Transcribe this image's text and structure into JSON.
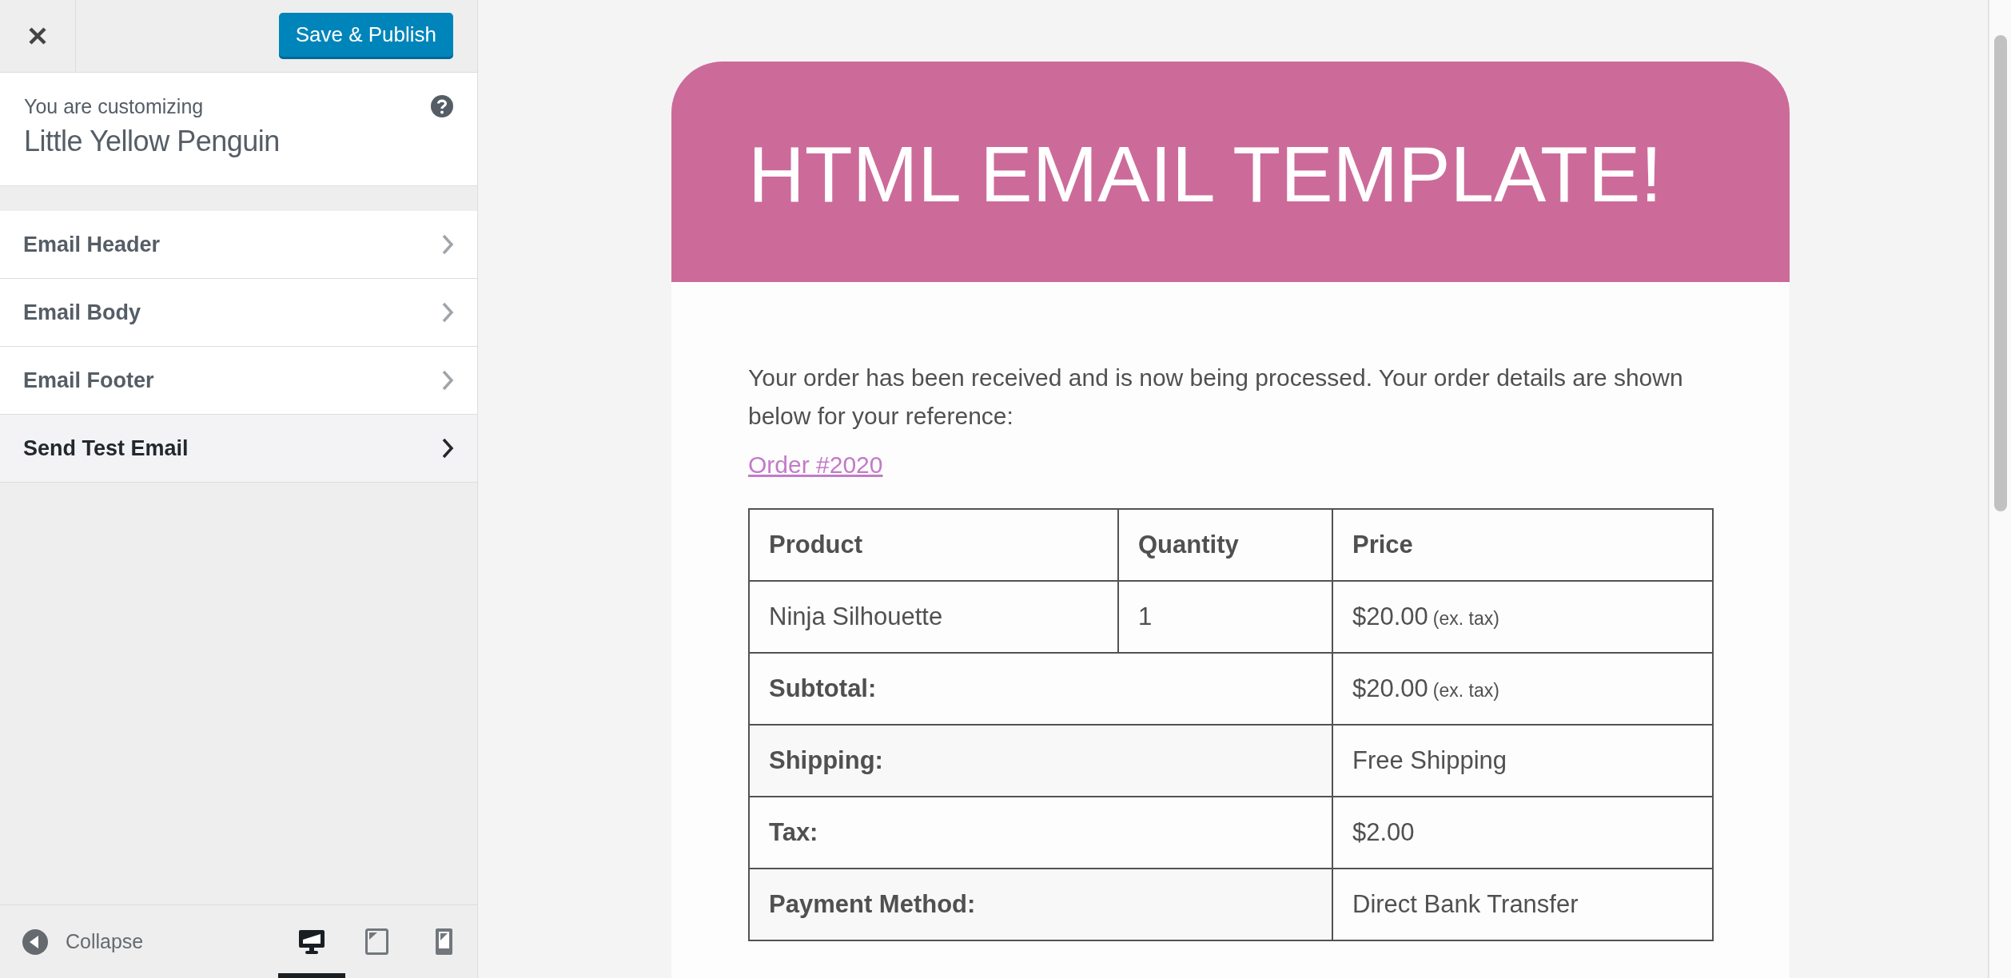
{
  "topbar": {
    "save_button": "Save & Publish"
  },
  "customizing": {
    "label": "You are customizing",
    "title": "Little Yellow Penguin"
  },
  "sections": [
    {
      "label": "Email Header",
      "selected": false
    },
    {
      "label": "Email Body",
      "selected": false
    },
    {
      "label": "Email Footer",
      "selected": false
    },
    {
      "label": "Send Test Email",
      "selected": true
    }
  ],
  "footer": {
    "collapse": "Collapse",
    "devices": [
      {
        "kind": "desktop",
        "selected": true
      },
      {
        "kind": "tablet",
        "selected": false
      },
      {
        "kind": "mobile",
        "selected": false
      }
    ]
  },
  "email": {
    "heading": "HTML EMAIL TEMPLATE!",
    "intro": "Your order has been received and is now being processed. Your order details are shown below for your reference:",
    "order_link": "Order #2020",
    "table": {
      "columns": [
        "Product",
        "Quantity",
        "Price"
      ],
      "items": [
        {
          "product": "Ninja Silhouette",
          "quantity": "1",
          "price": "$20.00",
          "note": "(ex. tax)"
        }
      ],
      "totals": [
        {
          "label": "Subtotal:",
          "value": "$20.00",
          "note": "(ex. tax)"
        },
        {
          "label": "Shipping:",
          "value": "Free Shipping"
        },
        {
          "label": "Tax:",
          "value": "$2.00"
        },
        {
          "label": "Payment Method:",
          "value": "Direct Bank Transfer"
        }
      ]
    }
  }
}
